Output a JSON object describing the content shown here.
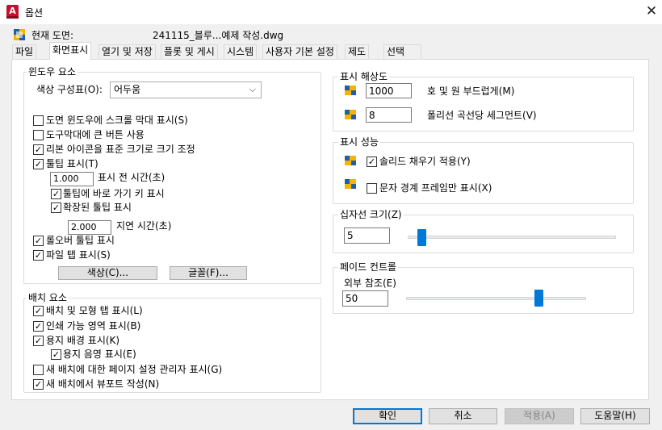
{
  "window": {
    "title": "옵션",
    "close_symbol": "✕"
  },
  "current_drawing": {
    "label": "현재 도면:",
    "filename": "241115_블루...예제 작성.dwg"
  },
  "tabs": [
    "파일",
    "화면표시",
    "열기 및 저장",
    "플롯 및 게시",
    "시스템",
    "사용자 기본 설정",
    "제도",
    "선택"
  ],
  "active_tab": "화면표시",
  "window_elements": {
    "title": "윈도우 요소",
    "color_scheme_label": "색상 구성표(O):",
    "color_scheme_value": "어두움",
    "checkboxes": [
      {
        "label": "도면 윈도우에 스크롤 막대 표시(S)",
        "checked": false
      },
      {
        "label": "도구막대에 큰 버튼 사용",
        "checked": false
      },
      {
        "label": "리본 아이콘을 표준 크기로 크기 조정",
        "checked": true
      },
      {
        "label": "툴팁 표시(T)",
        "checked": true
      }
    ],
    "tooltip_delay_value": "1.000",
    "tooltip_delay_label": "표시 전 시간(초)",
    "tooltip_shortcut": {
      "label": "툴팁에 바로 가기 키 표시",
      "checked": true
    },
    "extended_tooltip": {
      "label": "확장된 툴팁 표시",
      "checked": true
    },
    "extended_delay_value": "2.000",
    "extended_delay_label": "지연 시간(초)",
    "rollover_tooltip": {
      "label": "롤오버 툴팁 표시",
      "checked": true
    },
    "file_tabs": {
      "label": "파일 탭 표시(S)",
      "checked": true
    },
    "colors_button": "색상(C)...",
    "fonts_button": "글꼴(F)..."
  },
  "layout_elements": {
    "title": "배치 요소",
    "checkboxes": [
      {
        "label": "배치 및 모형 탭 표시(L)",
        "checked": true
      },
      {
        "label": "인쇄 가능 영역 표시(B)",
        "checked": true
      },
      {
        "label": "용지 배경 표시(K)",
        "checked": true
      }
    ],
    "paper_shadow": {
      "label": "용지 음영 표시(E)",
      "checked": true
    },
    "checkboxes2": [
      {
        "label": "새 배치에 대한 페이지 설정 관리자 표시(G)",
        "checked": false
      },
      {
        "label": "새 배치에서 뷰포트 작성(N)",
        "checked": true
      }
    ]
  },
  "display_resolution": {
    "title": "표시 해상도",
    "arc_smoothness_value": "1000",
    "arc_smoothness_label": "호 및 원 부드럽게(M)",
    "polyline_segments_value": "8",
    "polyline_segments_label": "폴리선 곡선당 세그먼트(V)"
  },
  "display_performance": {
    "title": "표시 성능",
    "solid_fill": {
      "label": "솔리드 채우기 적용(Y)",
      "checked": true
    },
    "text_boundary": {
      "label": "문자 경계 프레임만 표시(X)",
      "checked": false
    }
  },
  "crosshair_size": {
    "title": "십자선 크기(Z)",
    "value": "5",
    "slider_fraction": 0.05
  },
  "fade_control": {
    "title": "페이드 컨트롤",
    "xref_label": "외부 참조(E)",
    "value": "50",
    "slider_fraction": 0.75
  },
  "footer": {
    "ok": "확인",
    "cancel": "취소",
    "apply": "적용(A)",
    "help": "도움말(H)"
  },
  "colors": {
    "accent": "#0078d7",
    "app_red": "#c8102e"
  }
}
